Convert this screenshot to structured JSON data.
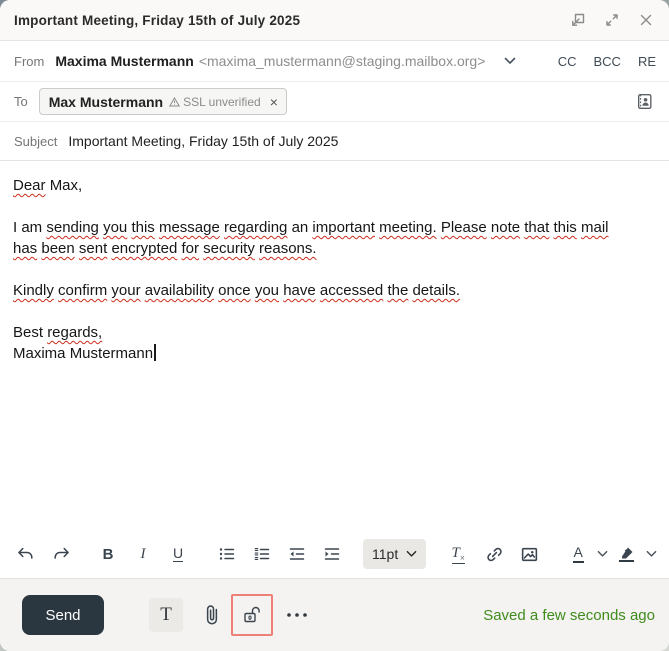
{
  "window": {
    "title": "Important Meeting, Friday 15th of July 2025"
  },
  "from_row": {
    "label": "From",
    "sender_name": "Maxima Mustermann",
    "sender_email": "<maxima_mustermann@staging.mailbox.org>",
    "cc_label": "CC",
    "bcc_label": "BCC",
    "re_label": "RE"
  },
  "to_row": {
    "label": "To",
    "recipient": {
      "name": "Max Mustermann",
      "status": "SSL unverified"
    }
  },
  "subject_row": {
    "label": "Subject",
    "value": "Important Meeting, Friday 15th of July 2025"
  },
  "body": {
    "paragraphs": [
      {
        "lines": [
          [
            [
              "Dear",
              1
            ],
            [
              "Max,",
              0
            ]
          ]
        ]
      },
      {
        "lines": [
          []
        ]
      },
      {
        "lines": [
          [
            [
              "I",
              0
            ],
            [
              "am",
              0
            ],
            [
              "sending",
              1
            ],
            [
              "you",
              1
            ],
            [
              "this",
              1
            ],
            [
              "message",
              1
            ],
            [
              "regarding",
              1
            ],
            [
              "an",
              0
            ],
            [
              "important",
              1
            ],
            [
              "meeting.",
              1
            ],
            [
              "Please",
              1
            ],
            [
              "note",
              1
            ],
            [
              "that",
              1
            ],
            [
              "this",
              1
            ],
            [
              "mail",
              1
            ]
          ],
          [
            [
              "has",
              1
            ],
            [
              "been",
              1
            ],
            [
              "sent",
              1
            ],
            [
              "encrypted",
              1
            ],
            [
              "for",
              1
            ],
            [
              "security",
              1
            ],
            [
              "reasons.",
              1
            ]
          ]
        ]
      },
      {
        "lines": [
          []
        ]
      },
      {
        "lines": [
          [
            [
              "Kindly",
              1
            ],
            [
              "confirm",
              1
            ],
            [
              "your",
              1
            ],
            [
              "availability",
              1
            ],
            [
              "once",
              1
            ],
            [
              "you",
              1
            ],
            [
              "have",
              1
            ],
            [
              "accessed",
              1
            ],
            [
              "the",
              1
            ],
            [
              "details.",
              1
            ]
          ]
        ]
      },
      {
        "lines": [
          []
        ]
      },
      {
        "lines": [
          [
            [
              "Best",
              0
            ],
            [
              "regards,",
              1
            ]
          ]
        ]
      },
      {
        "lines": [
          [
            [
              "Maxima",
              0
            ],
            [
              "Mustermann",
              0
            ]
          ]
        ],
        "caret": true
      }
    ]
  },
  "toolbar": {
    "bold_glyph": "B",
    "italic_glyph": "I",
    "underline_glyph": "U",
    "font_size": "11pt",
    "clear_format_glyph": "T",
    "text_color_glyph": "A"
  },
  "footer": {
    "send_label": "Send",
    "plain_text_glyph": "T",
    "saved_status": "Saved a few seconds ago"
  },
  "colors": {
    "send_button_bg": "#2b3740",
    "saved_green": "#3f8c1c",
    "squiggle_red": "#cc2d1c",
    "encrypt_focus_border": "#ee7f78"
  }
}
